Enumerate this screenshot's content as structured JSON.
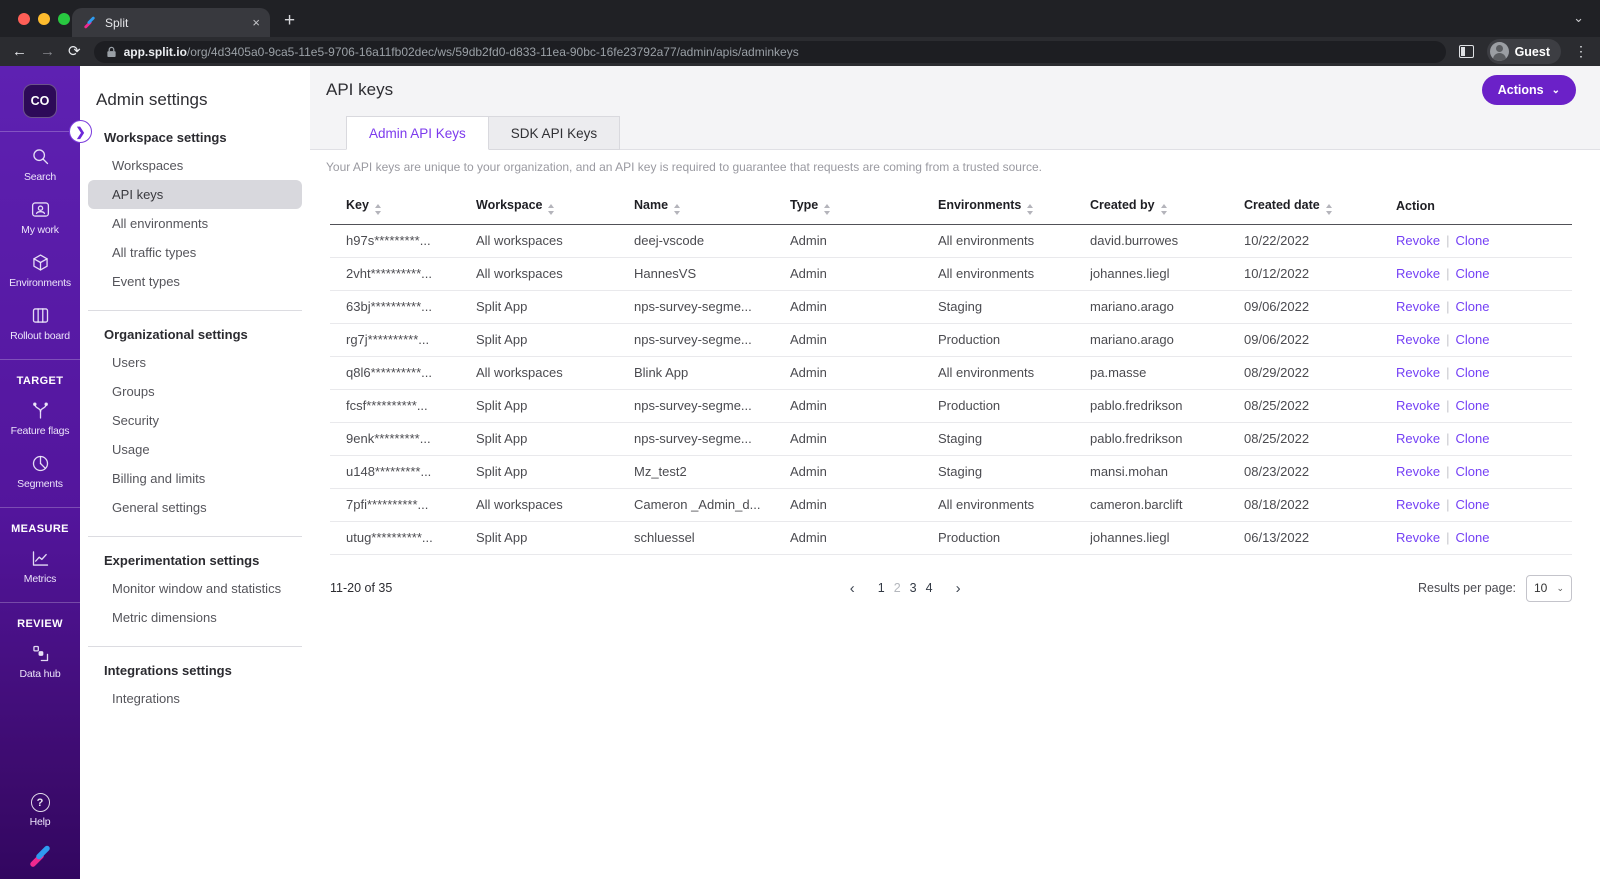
{
  "colors": {
    "accent_button": "#6b21c8",
    "link_purple": "#7440f5",
    "active_tab_text": "#7c3aed",
    "sidebar_purple_top": "#5e21b2",
    "sidebar_purple_bottom": "#320660"
  },
  "icons": {
    "close": "×",
    "new_tab": "+",
    "kebab": "⋮",
    "chevron_down": "⌄",
    "back": "←",
    "forward": "→",
    "reload": "⟳",
    "expander": "❯",
    "page_prev": "‹",
    "page_next": "›",
    "help": "?",
    "actions_chevron": "⌄",
    "select_chevron": "⌄"
  },
  "browser": {
    "tab_title": "Split",
    "url_host": "app.split.io",
    "url_path": "/org/4d3405a0-9ca5-11e5-9706-16a11fb02dec/ws/59db2fd0-d833-11ea-90bc-16fe23792a77/admin/apis/adminkeys",
    "profile_label": "Guest"
  },
  "sidebar": {
    "logo_text": "CO",
    "groups": [
      {
        "label": "",
        "items": [
          {
            "name": "search",
            "label": "Search"
          },
          {
            "name": "my-work",
            "label": "My work"
          },
          {
            "name": "environments",
            "label": "Environments"
          },
          {
            "name": "rollout-board",
            "label": "Rollout board"
          }
        ]
      },
      {
        "label": "TARGET",
        "items": [
          {
            "name": "feature-flags",
            "label": "Feature flags"
          },
          {
            "name": "segments",
            "label": "Segments"
          }
        ]
      },
      {
        "label": "MEASURE",
        "items": [
          {
            "name": "metrics",
            "label": "Metrics"
          }
        ]
      },
      {
        "label": "REVIEW",
        "items": [
          {
            "name": "data-hub",
            "label": "Data hub"
          }
        ]
      }
    ],
    "help_label": "Help"
  },
  "settings_nav": {
    "title": "Admin settings",
    "sections": [
      {
        "header": "Workspace settings",
        "selected": "API keys",
        "items": [
          "Workspaces",
          "API keys",
          "All environments",
          "All traffic types",
          "Event types"
        ]
      },
      {
        "header": "Organizational settings",
        "selected": "",
        "items": [
          "Users",
          "Groups",
          "Security",
          "Usage",
          "Billing and limits",
          "General settings"
        ]
      },
      {
        "header": "Experimentation settings",
        "selected": "",
        "items": [
          "Monitor window and statistics",
          "Metric dimensions"
        ]
      },
      {
        "header": "Integrations settings",
        "selected": "",
        "items": [
          "Integrations"
        ]
      }
    ]
  },
  "main": {
    "title": "API keys",
    "actions_label": "Actions",
    "tabs": [
      {
        "label": "Admin API Keys",
        "active": true
      },
      {
        "label": "SDK API Keys",
        "active": false
      }
    ],
    "description": "Your API keys are unique to your organization, and an API key is required to guarantee that requests are coming from a trusted source.",
    "table": {
      "columns": [
        {
          "label": "Key",
          "sortable": true
        },
        {
          "label": "Workspace",
          "sortable": true
        },
        {
          "label": "Name",
          "sortable": true
        },
        {
          "label": "Type",
          "sortable": true
        },
        {
          "label": "Environments",
          "sortable": true
        },
        {
          "label": "Created by",
          "sortable": true
        },
        {
          "label": "Created date",
          "sortable": true
        },
        {
          "label": "Action",
          "sortable": false
        }
      ],
      "action_labels": {
        "revoke": "Revoke",
        "separator": "|",
        "clone": "Clone"
      },
      "rows": [
        {
          "key": "h97s*********...",
          "workspace": "All workspaces",
          "name": "deej-vscode",
          "type": "Admin",
          "environments": "All environments",
          "created_by": "david.burrowes",
          "created_date": "10/22/2022"
        },
        {
          "key": "2vht**********...",
          "workspace": "All workspaces",
          "name": "HannesVS",
          "type": "Admin",
          "environments": "All environments",
          "created_by": "johannes.liegl",
          "created_date": "10/12/2022"
        },
        {
          "key": "63bj**********...",
          "workspace": "Split App",
          "name": "nps-survey-segme...",
          "type": "Admin",
          "environments": "Staging",
          "created_by": "mariano.arago",
          "created_date": "09/06/2022"
        },
        {
          "key": "rg7j**********...",
          "workspace": "Split App",
          "name": "nps-survey-segme...",
          "type": "Admin",
          "environments": "Production",
          "created_by": "mariano.arago",
          "created_date": "09/06/2022"
        },
        {
          "key": "q8l6**********...",
          "workspace": "All workspaces",
          "name": "Blink App",
          "type": "Admin",
          "environments": "All environments",
          "created_by": "pa.masse",
          "created_date": "08/29/2022"
        },
        {
          "key": "fcsf**********...",
          "workspace": "Split App",
          "name": "nps-survey-segme...",
          "type": "Admin",
          "environments": "Production",
          "created_by": "pablo.fredrikson",
          "created_date": "08/25/2022"
        },
        {
          "key": "9enk*********...",
          "workspace": "Split App",
          "name": "nps-survey-segme...",
          "type": "Admin",
          "environments": "Staging",
          "created_by": "pablo.fredrikson",
          "created_date": "08/25/2022"
        },
        {
          "key": "u148*********...",
          "workspace": "Split App",
          "name": "Mz_test2",
          "type": "Admin",
          "environments": "Staging",
          "created_by": "mansi.mohan",
          "created_date": "08/23/2022"
        },
        {
          "key": "7pfi**********...",
          "workspace": "All workspaces",
          "name": "Cameron _Admin_d...",
          "type": "Admin",
          "environments": "All environments",
          "created_by": "cameron.barclift",
          "created_date": "08/18/2022"
        },
        {
          "key": "utug**********...",
          "workspace": "Split App",
          "name": "schluessel",
          "type": "Admin",
          "environments": "Production",
          "created_by": "johannes.liegl",
          "created_date": "06/13/2022"
        }
      ]
    },
    "pagination": {
      "range_text": "11-20 of 35",
      "pages": [
        "1",
        "2",
        "3",
        "4"
      ],
      "current_page": "2",
      "results_per_page_label": "Results per page:",
      "results_per_page_value": "10"
    }
  }
}
